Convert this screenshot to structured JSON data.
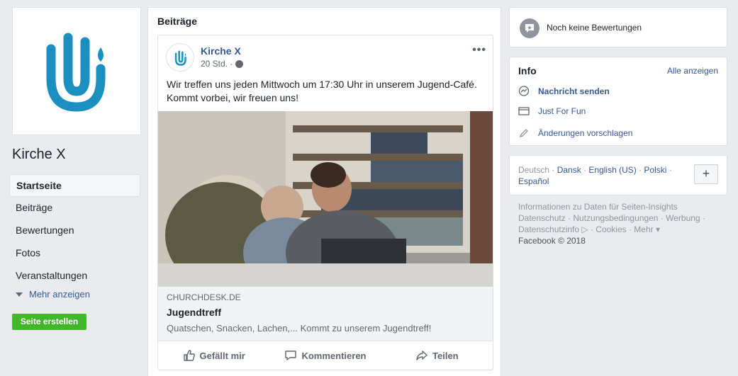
{
  "left": {
    "page_name": "Kirche X",
    "nav": [
      {
        "label": "Startseite"
      },
      {
        "label": "Beiträge"
      },
      {
        "label": "Bewertungen"
      },
      {
        "label": "Fotos"
      },
      {
        "label": "Veranstaltungen"
      }
    ],
    "more_label": "Mehr anzeigen",
    "create_page_label": "Seite erstellen"
  },
  "center": {
    "title": "Beiträge",
    "post": {
      "author": "Kirche X",
      "time": "20 Std. ·",
      "text": "Wir treffen uns jeden Mittwoch um 17:30 Uhr in unserem Jugend-Café. Kommt vorbei, wir freuen uns!",
      "link_domain": "CHURCHDESK.DE",
      "link_title": "Jugendtreff",
      "link_description": "Quatschen, Snacken, Lachen,... Kommt zu unserem Jugendtreff!",
      "actions": [
        "Gefällt mir",
        "Kommentieren",
        "Teilen"
      ]
    }
  },
  "right": {
    "reviews_text": "Noch keine Bewertungen",
    "info": {
      "title": "Info",
      "see_all": "Alle anzeigen",
      "rows": [
        "Nachricht senden",
        "Just For Fun",
        "Änderungen vorschlagen"
      ]
    },
    "languages": {
      "current": "Deutsch",
      "sep": " · ",
      "options": [
        "Dansk",
        "English (US)",
        "Polski",
        "Español"
      ],
      "add": "+"
    },
    "footer": {
      "line1": "Informationen zu Daten für Seiten-Insights",
      "line2": "Datenschutz · Nutzungsbedingungen · Werbung ·",
      "line3": "Datenschutzinfo ▷ · Cookies · Mehr ▾",
      "line4": "Facebook © 2018"
    }
  },
  "colors": {
    "brand_blue": "#1a8fc0",
    "link": "#365899",
    "green": "#42b72a",
    "background": "#e9ebee"
  }
}
